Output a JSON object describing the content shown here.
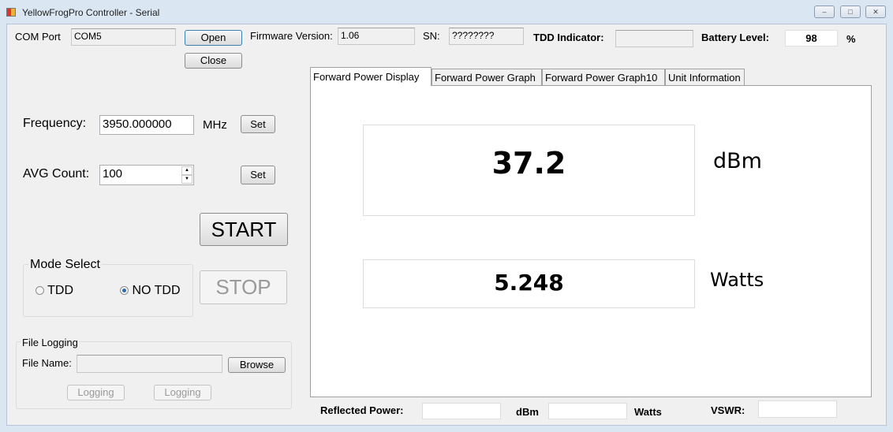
{
  "window": {
    "title": "YellowFrogPro Controller - Serial",
    "minimize": "‒",
    "maximize": "□",
    "close": "✕"
  },
  "top": {
    "com_port_label": "COM Port",
    "com_port_value": "COM5",
    "open": "Open",
    "close": "Close",
    "firmware_label": "Firmware Version:",
    "firmware_value": "1.06",
    "sn_label": "SN:",
    "sn_value": "????????",
    "tdd_label": "TDD Indicator:",
    "tdd_value": "",
    "battery_label": "Battery Level:",
    "battery_value": "98",
    "battery_unit": "%"
  },
  "controls": {
    "frequency_label": "Frequency:",
    "frequency_value": "3950.000000",
    "frequency_unit": "MHz",
    "set": "Set",
    "avg_label": "AVG Count:",
    "avg_value": "100",
    "start": "START",
    "stop": "STOP"
  },
  "mode": {
    "title": "Mode Select",
    "options": [
      {
        "label": "TDD",
        "selected": false
      },
      {
        "label": "NO TDD",
        "selected": true
      }
    ]
  },
  "logging": {
    "title": "File Logging",
    "file_name_label": "File Name:",
    "file_name_value": "",
    "browse": "Browse",
    "logging1": "Logging",
    "logging2": "Logging"
  },
  "tabs": [
    {
      "label": "Forward Power Display",
      "selected": true
    },
    {
      "label": "Forward Power Graph"
    },
    {
      "label": "Forward Power Graph10"
    },
    {
      "label": "Unit Information"
    }
  ],
  "display": {
    "dbm_value": "37.2",
    "dbm_unit": "dBm",
    "watts_value": "5.248",
    "watts_unit": "Watts"
  },
  "bottom": {
    "reflected_label": "Reflected Power:",
    "reflected_dbm": "",
    "dbm_unit": "dBm",
    "reflected_watts": "",
    "watts_unit": "Watts",
    "vswr_label": "VSWR:",
    "vswr_value": ""
  }
}
